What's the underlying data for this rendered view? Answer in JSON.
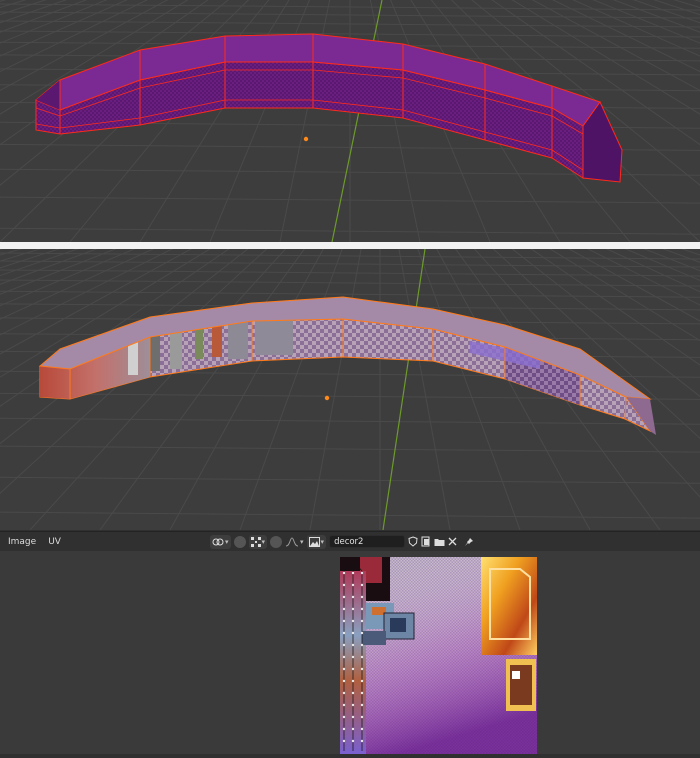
{
  "header": {
    "menu": [
      "Image",
      "UV"
    ],
    "image_name": "decor2"
  },
  "icons": {
    "link": "link-icon",
    "pivot": "pivot-icon",
    "snap": "snap-grid-icon",
    "proportional": "proportional-edit-icon",
    "falloff": "falloff-curve-icon",
    "image_browse": "image-browse-icon",
    "fake_user": "fake-user-shield-icon",
    "new_image": "new-image-icon",
    "open_image": "folder-icon",
    "unlink": "close-icon",
    "pin": "pin-icon"
  },
  "colors": {
    "selection_top": "#ff2a1a",
    "selection_bottom": "#ff7a1a",
    "mesh_purple": "#6e1f86",
    "axis_y": "#6d9a2a",
    "origin": "#ff8a1a"
  }
}
